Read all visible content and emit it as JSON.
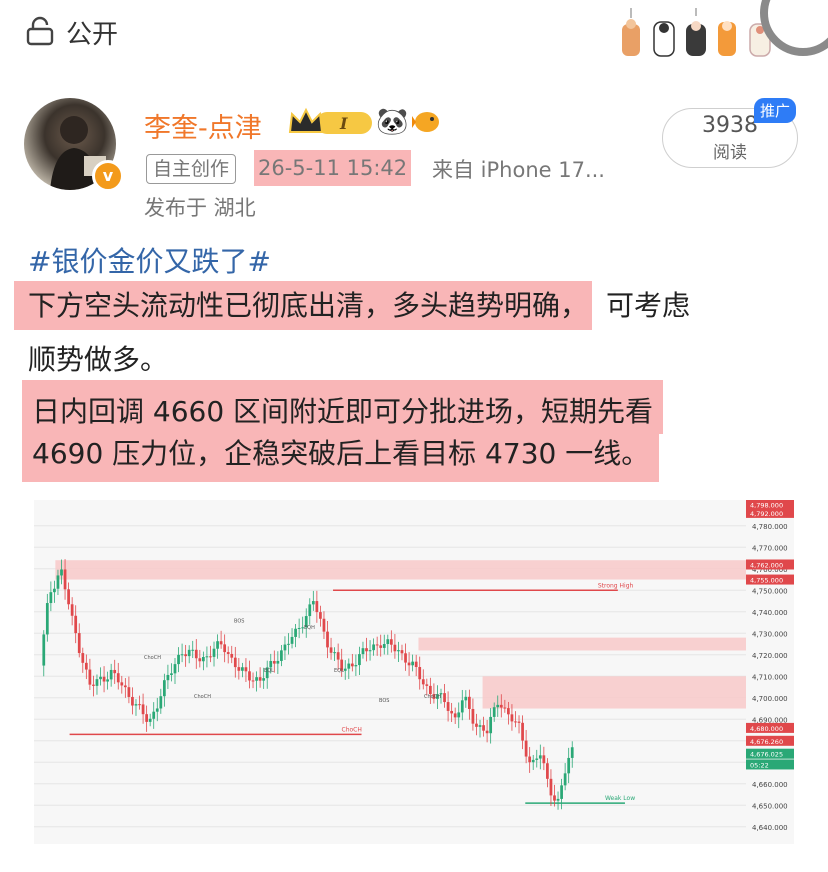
{
  "topbar": {
    "public_label": "公开"
  },
  "post": {
    "username": "李奎-点津",
    "tag": "自主创作",
    "time": "26-5-11 15:42",
    "source": "来自 iPhone 17...",
    "location": "发布于 湖北",
    "reads": {
      "count": "3938",
      "label": "阅读"
    },
    "promo": "推广",
    "hashtag": "#银价金价又跌了#",
    "para1_hl": "下方空头流动性已彻底出清，多头趋势明确，",
    "para1_rest": "可考虑",
    "para2": "顺势做多。",
    "para3_line1": "日内回调 4660 区间附近即可分批进场，短期先看",
    "para3_line2": "4690 压力位，企稳突破后上看目标 4730 一线。"
  },
  "icons": {
    "lock": "lock-icon",
    "cats": "cat-paws-decoration",
    "crown": "crown-badge-icon",
    "panda": "panda-icon",
    "fish": "fish-icon",
    "verified": "verified-v-badge"
  },
  "colors": {
    "username": "#f0772a",
    "hashtag": "#3466a8",
    "highlight": "#f9b6b7",
    "bull": "#2aa876",
    "bear": "#e0484b",
    "promo": "#2e7cf6"
  },
  "chart_data": {
    "type": "candlestick",
    "y_ticks": [
      4640,
      4650,
      4660,
      4670,
      4680,
      4690,
      4700,
      4710,
      4720,
      4730,
      4740,
      4750,
      4760,
      4770,
      4780
    ],
    "y_tick_labels": [
      "4,640.000",
      "4,650.000",
      "4,660.000",
      "4,670.000",
      "4,680.000",
      "4,690.000",
      "4,700.000",
      "4,710.000",
      "4,720.000",
      "4,730.000",
      "4,740.000",
      "4,750.000",
      "4,760.000",
      "4,770.000",
      "4,780.000"
    ],
    "ylim": [
      4632,
      4792
    ],
    "price_tags": [
      {
        "label": "4,798.000",
        "value": 4790,
        "color": "#e0484b"
      },
      {
        "label": "4,792.000",
        "value": 4786,
        "color": "#e0484b"
      },
      {
        "label": "4,762.000",
        "value": 4762,
        "color": "#e0484b"
      },
      {
        "label": "4,755.000",
        "value": 4755,
        "color": "#e0484b"
      },
      {
        "label": "4,680.000",
        "value": 4686,
        "color": "#e0484b"
      },
      {
        "label": "4,676.260",
        "value": 4680,
        "color": "#e0484b"
      },
      {
        "label": "4,676.025",
        "value": 4674,
        "color": "#2aa876"
      },
      {
        "label": "05:22",
        "value": 4669,
        "color": "#2aa876"
      }
    ],
    "zones": [
      {
        "from": 4755,
        "to": 4764,
        "x0": 0.03,
        "x1": 1.0
      },
      {
        "from": 4722,
        "to": 4728,
        "x0": 0.54,
        "x1": 1.0
      },
      {
        "from": 4695,
        "to": 4710,
        "x0": 0.63,
        "x1": 1.0
      }
    ],
    "levels": [
      {
        "value": 4750,
        "x0": 0.42,
        "x1": 0.82,
        "label": "Strong High",
        "color": "#e0484b"
      },
      {
        "value": 4683,
        "x0": 0.05,
        "x1": 0.46,
        "label": "ChoCH",
        "color": "#e0484b"
      },
      {
        "value": 4651,
        "x0": 0.69,
        "x1": 0.83,
        "label": "Weak Low",
        "color": "#2aa876"
      }
    ],
    "annotations": [
      "ChoCH",
      "BOS",
      "EQL",
      "EQH",
      "ChoCH",
      "EQL",
      "BOS",
      "ChoCH"
    ],
    "last_price": 4676.025,
    "countdown": "05:22"
  }
}
